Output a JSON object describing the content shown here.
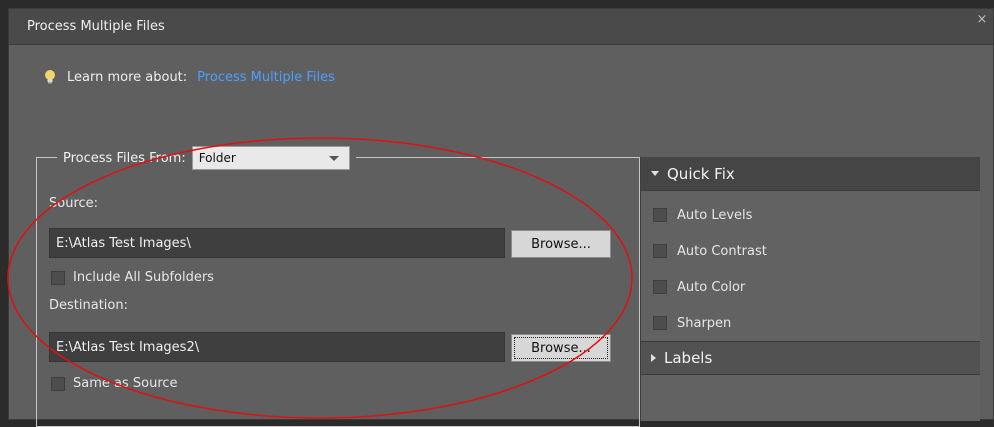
{
  "dialog": {
    "title": "Process Multiple Files",
    "close_glyph": "×"
  },
  "learn": {
    "label": "Learn more about:",
    "link": "Process Multiple Files"
  },
  "process_from": {
    "label": "Process Files From:",
    "selected": "Folder"
  },
  "source": {
    "label": "Source:",
    "path": "E:\\Atlas Test Images\\",
    "browse_label": "Browse...",
    "include_subfolders_label": "Include All Subfolders",
    "include_subfolders_checked": false
  },
  "destination": {
    "label": "Destination:",
    "path": "E:\\Atlas Test Images2\\",
    "browse_label": "Browse...",
    "same_as_source_label": "Same as Source",
    "same_as_source_checked": false
  },
  "quick_fix": {
    "header": "Quick Fix",
    "items": [
      {
        "label": "Auto Levels",
        "checked": false
      },
      {
        "label": "Auto Contrast",
        "checked": false
      },
      {
        "label": "Auto Color",
        "checked": false
      },
      {
        "label": "Sharpen",
        "checked": false
      }
    ]
  },
  "labels_panel": {
    "header": "Labels"
  },
  "colors": {
    "dialog_bg": "#5f5f5f",
    "link": "#4aa0ff",
    "annotation": "#e01010"
  },
  "icons": [
    "lightbulb-icon",
    "close-icon",
    "chevron-down-icon",
    "triangle-down-icon",
    "triangle-right-icon"
  ]
}
